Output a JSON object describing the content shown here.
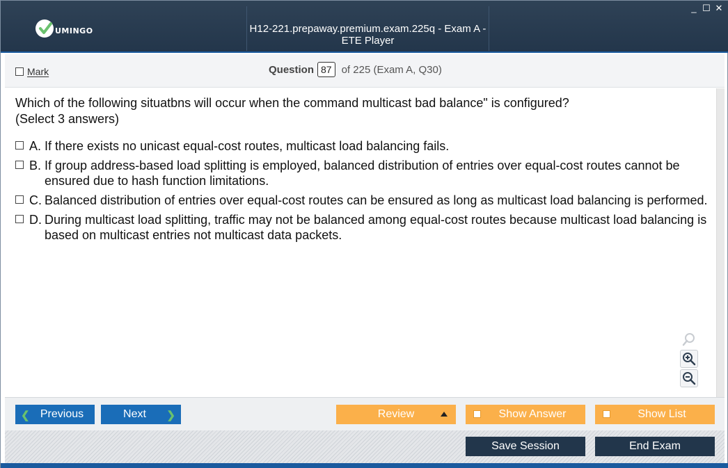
{
  "window": {
    "title": "H12-221.prepaway.premium.exam.225q - Exam A - ETE Player",
    "logo_text": "UMINGO",
    "controls": {
      "minimize": "_",
      "maximize": "☐",
      "close": "✕"
    }
  },
  "header": {
    "mark_label": "Mark",
    "question_label": "Question",
    "question_number": "87",
    "question_of": "of 225 (Exam A, Q30)"
  },
  "question": {
    "text": "Which of the following situatbns will occur when the command   multicast bad balance\" is configured? (Select 3 answers)",
    "answers": [
      {
        "letter": "A.",
        "text": "If there exists no unicast equal-cost routes, multicast load balancing fails."
      },
      {
        "letter": "B.",
        "text": "If group address-based load splitting is employed, balanced distribution of entries over equal-cost routes cannot be ensured due to hash function limitations."
      },
      {
        "letter": "C.",
        "text": "Balanced distribution of entries over equal-cost routes can be ensured as long as multicast load balancing is performed."
      },
      {
        "letter": "D.",
        "text": "During multicast load splitting, traffic may not be balanced among equal-cost routes  because multicast load balancing is based on multicast entries not multicast data packets."
      }
    ]
  },
  "zoom": {
    "icons": [
      "search-icon",
      "zoom-in-icon",
      "zoom-out-icon"
    ]
  },
  "nav": {
    "previous_label": "Previous",
    "next_label": "Next",
    "review_label": "Review",
    "show_answer_label": "Show Answer",
    "show_list_label": "Show List"
  },
  "footer": {
    "save_session_label": "Save Session",
    "end_exam_label": "End Exam"
  },
  "colors": {
    "titlebar": "#23364b",
    "accent_blue": "#1a6db8",
    "accent_orange": "#fbb04a",
    "dark_button": "#22364b",
    "logo_green": "#6ac16e"
  }
}
